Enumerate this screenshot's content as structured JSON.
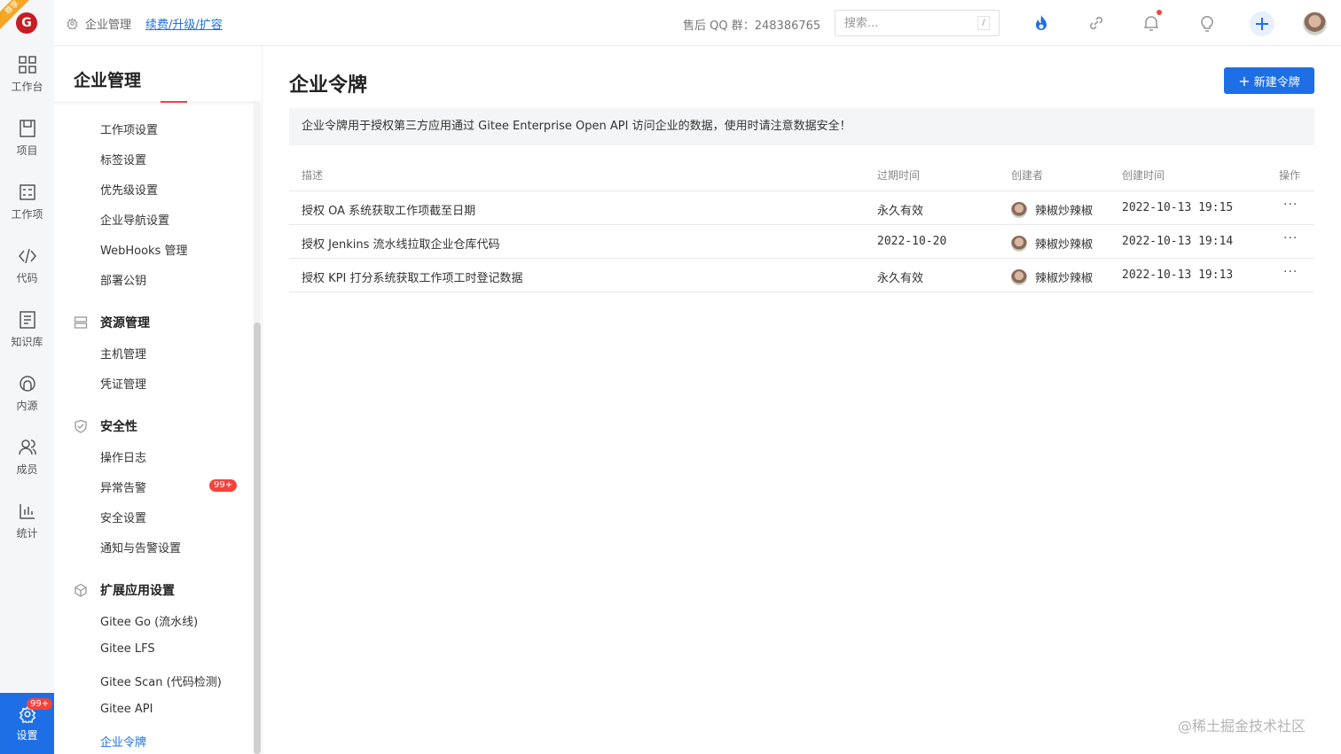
{
  "rail": {
    "ribbon": "尊享",
    "logo": "G",
    "items": [
      {
        "label": "工作台"
      },
      {
        "label": "项目"
      },
      {
        "label": "工作项"
      },
      {
        "label": "代码"
      },
      {
        "label": "知识库"
      },
      {
        "label": "内源"
      },
      {
        "label": "成员"
      },
      {
        "label": "统计"
      },
      {
        "label": "设置",
        "badge": "99+"
      }
    ]
  },
  "topbar": {
    "breadcrumb_root": "企业管理",
    "breadcrumb_link": "续费/升级/扩容",
    "qq_group": "售后 QQ 群：248386765",
    "search_placeholder": "搜索...",
    "search_shortcut": "/"
  },
  "subnav": {
    "title": "企业管理",
    "items_top": [
      "工作项设置",
      "标签设置",
      "优先级设置",
      "企业导航设置",
      "WebHooks 管理",
      "部署公钥"
    ],
    "group_resources": "资源管理",
    "items_resources": [
      "主机管理",
      "凭证管理"
    ],
    "group_security": "安全性",
    "items_security": [
      "操作日志",
      "异常告警",
      "安全设置",
      "通知与告警设置"
    ],
    "alert_badge": "99+",
    "group_extensions": "扩展应用设置",
    "items_extensions": [
      "Gitee Go (流水线)",
      "Gitee LFS",
      "Gitee Scan (代码检测)",
      "Gitee API",
      "企业令牌"
    ]
  },
  "main": {
    "title": "企业令牌",
    "new_button": "新建令牌",
    "notice": "企业令牌用于授权第三方应用通过 Gitee Enterprise Open API 访问企业的数据，使用时请注意数据安全！",
    "columns": {
      "desc": "描述",
      "expires": "过期时间",
      "creator": "创建者",
      "created": "创建时间",
      "ops": "操作"
    },
    "rows": [
      {
        "desc": "授权 OA 系统获取工作项截至日期",
        "expires": "永久有效",
        "creator": "辣椒炒辣椒",
        "created": "2022-10-13 19:15",
        "ops": "···"
      },
      {
        "desc": "授权 Jenkins 流水线拉取企业仓库代码",
        "expires": "2022-10-20",
        "creator": "辣椒炒辣椒",
        "created": "2022-10-13 19:14",
        "ops": "···"
      },
      {
        "desc": "授权 KPI 打分系统获取工作项工时登记数据",
        "expires": "永久有效",
        "creator": "辣椒炒辣椒",
        "created": "2022-10-13 19:13",
        "ops": "···"
      }
    ]
  },
  "credit": "@稀土掘金技术社区",
  "colors": {
    "accent": "#1e6fe6",
    "badge": "#f5433b",
    "brand": "#c71d23"
  }
}
